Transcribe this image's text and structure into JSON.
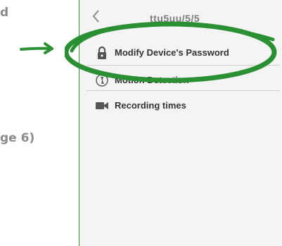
{
  "doc": {
    "fragment_top": "d",
    "fragment_bottom": "ge 6)"
  },
  "screen": {
    "title": "ttu5uu/5/5",
    "menu": [
      {
        "label": "Modify Device's Password",
        "icon": "lock-icon"
      },
      {
        "label": "Motion Detection",
        "icon": "motion-icon"
      },
      {
        "label": "Recording times",
        "icon": "video-camera-icon"
      }
    ]
  },
  "colors": {
    "annotation": "#2b8f33",
    "text": "#333333"
  }
}
